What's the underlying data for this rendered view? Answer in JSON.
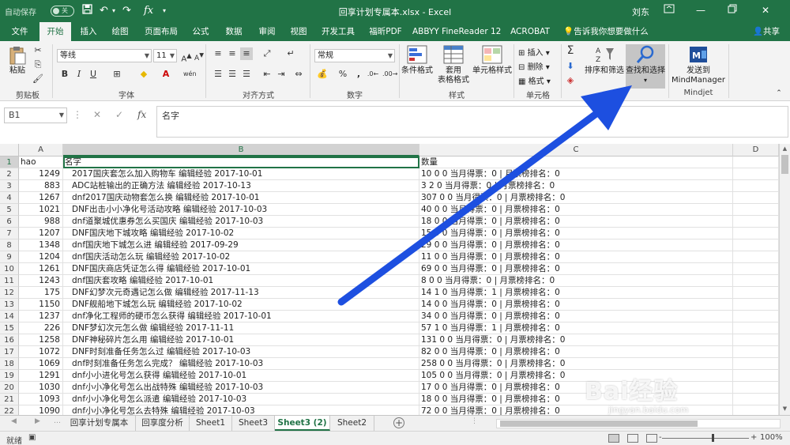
{
  "titlebar": {
    "autosave_label": "自动保存",
    "autosave_state": "关",
    "doc_title": "回享计划专属本.xlsx  -  Excel",
    "user": "刘东",
    "font_icon": "fx"
  },
  "ribbon_tabs": [
    "文件",
    "开始",
    "插入",
    "绘图",
    "页面布局",
    "公式",
    "数据",
    "审阅",
    "视图",
    "开发工具",
    "福昕PDF",
    "ABBYY FineReader 12",
    "ACROBAT"
  ],
  "tell_me": "告诉我你想要做什么",
  "share": "共享",
  "ribbon": {
    "paste": "粘贴",
    "clipboard": "剪贴板",
    "font_name": "等线",
    "font_size": "11",
    "font_group": "字体",
    "align_group": "对齐方式",
    "number_format": "常规",
    "number_group": "数字",
    "cond_format": "条件格式",
    "table_format": "套用\n表格格式",
    "cell_style": "单元格样式",
    "style_group": "样式",
    "insert": "插入",
    "delete": "删除",
    "format": "格式",
    "cells_group": "单元格",
    "sort_filter": "排序和筛选",
    "find_select": "查找和选择",
    "edit_group": "编辑",
    "send_to": "发送到",
    "mindmanager": "MindManager",
    "mindjet": "Mindjet",
    "bold": "B",
    "italic": "I",
    "underline": "U",
    "percent": "%",
    "comma": ",",
    "wen": "wén"
  },
  "formula": {
    "name_box": "B1",
    "content": "名字",
    "fx": "fx"
  },
  "columns": [
    "A",
    "B",
    "C",
    "D"
  ],
  "rows": [
    {
      "n": "1",
      "a": "hao",
      "b": "名字",
      "c": "数量"
    },
    {
      "n": "2",
      "a": "1249",
      "b": "2017国庆套怎么加入购物车 编辑经验 2017-10-01",
      "c": "10 0 0 当月得票：0 | 月票榜排名：0"
    },
    {
      "n": "3",
      "a": "883",
      "b": "ADC站桩输出的正确方法 编辑经验 2017-10-13",
      "c": "3 2 0 当月得票：0 | 月票榜排名：0"
    },
    {
      "n": "4",
      "a": "1267",
      "b": "dnf2017国庆动物套怎么换 编辑经验 2017-10-01",
      "c": "307 0 0 当月得票：0 | 月票榜排名：0"
    },
    {
      "n": "5",
      "a": "1021",
      "b": "DNF出击小小净化号活动攻略 编辑经验 2017-10-03",
      "c": "40 0 0 当月得票：0 | 月票榜排名：0"
    },
    {
      "n": "6",
      "a": "988",
      "b": "dnf道聚城优惠券怎么买国庆 编辑经验 2017-10-03",
      "c": "18 0 0 当月得票：0 | 月票榜排名：0"
    },
    {
      "n": "7",
      "a": "1207",
      "b": "DNF国庆地下城攻略 编辑经验 2017-10-02",
      "c": "15 0 0 当月得票：0 | 月票榜排名：0"
    },
    {
      "n": "8",
      "a": "1348",
      "b": "dnf国庆地下城怎么进 编辑经验 2017-09-29",
      "c": "29 0 0 当月得票：0 | 月票榜排名：0"
    },
    {
      "n": "9",
      "a": "1204",
      "b": "dnf国庆活动怎么玩 编辑经验 2017-10-02",
      "c": "11 0 0 当月得票：0 | 月票榜排名：0"
    },
    {
      "n": "10",
      "a": "1261",
      "b": "DNF国庆商店凭证怎么得 编辑经验 2017-10-01",
      "c": "69 0 0 当月得票：0 | 月票榜排名：0"
    },
    {
      "n": "11",
      "a": "1243",
      "b": "dnf国庆套攻略 编辑经验 2017-10-01",
      "c": "8 0 0 当月得票：0 | 月票榜排名：0"
    },
    {
      "n": "12",
      "a": "175",
      "b": "DNF幻梦次元奇遇记怎么做 编辑经验 2017-11-13",
      "c": "14 1 0 当月得票：1 | 月票榜排名：0"
    },
    {
      "n": "13",
      "a": "1150",
      "b": "DNF舰船地下城怎么玩 编辑经验 2017-10-02",
      "c": "14 0 0 当月得票：0 | 月票榜排名：0"
    },
    {
      "n": "14",
      "a": "1237",
      "b": "dnf净化工程师的硬币怎么获得 编辑经验 2017-10-01",
      "c": "34 0 0 当月得票：0 | 月票榜排名：0"
    },
    {
      "n": "15",
      "a": "226",
      "b": "DNF梦幻次元怎么做 编辑经验 2017-11-11",
      "c": "57 1 0 当月得票：1 | 月票榜排名：0"
    },
    {
      "n": "16",
      "a": "1258",
      "b": "DNF神秘碎片怎么用 编辑经验 2017-10-01",
      "c": "131 0 0 当月得票：0 | 月票榜排名：0"
    },
    {
      "n": "17",
      "a": "1072",
      "b": "DNF时刻准备任务怎么过 编辑经验 2017-10-03",
      "c": "82 0 0 当月得票：0 | 月票榜排名：0"
    },
    {
      "n": "18",
      "a": "1069",
      "b": "dnf时刻准备任务怎么完成？ 编辑经验 2017-10-03",
      "c": "258 0 0 当月得票：0 | 月票榜排名：0"
    },
    {
      "n": "19",
      "a": "1291",
      "b": "dnf小小进化号怎么获得 编辑经验 2017-10-01",
      "c": "105 0 0 当月得票：0 | 月票榜排名：0"
    },
    {
      "n": "20",
      "a": "1030",
      "b": "dnf小小净化号怎么出战特殊 编辑经验 2017-10-03",
      "c": "17 0 0 当月得票：0 | 月票榜排名：0"
    },
    {
      "n": "21",
      "a": "1093",
      "b": "dnf小小净化号怎么派遣 编辑经验 2017-10-03",
      "c": "18 0 0 当月得票：0 | 月票榜排名：0"
    },
    {
      "n": "22",
      "a": "1090",
      "b": "dnf小小净化号怎么去特殊 编辑经验 2017-10-03",
      "c": "72 0 0 当月得票：0 | 月票榜排名：0"
    }
  ],
  "sheets": [
    "回享计划专属本",
    "回享度分析",
    "Sheet1",
    "Sheet3",
    "Sheet3 (2)",
    "Sheet2"
  ],
  "active_sheet": "Sheet3 (2)",
  "status": {
    "ready": "就绪",
    "zoom": "100%",
    "minus": "-",
    "plus": "+"
  },
  "watermark": {
    "brand": "Bai经验",
    "url": "jingyan.baidu.com"
  },
  "colors": {
    "excel_green": "#217346",
    "arrow_blue": "#1d4fe0"
  }
}
